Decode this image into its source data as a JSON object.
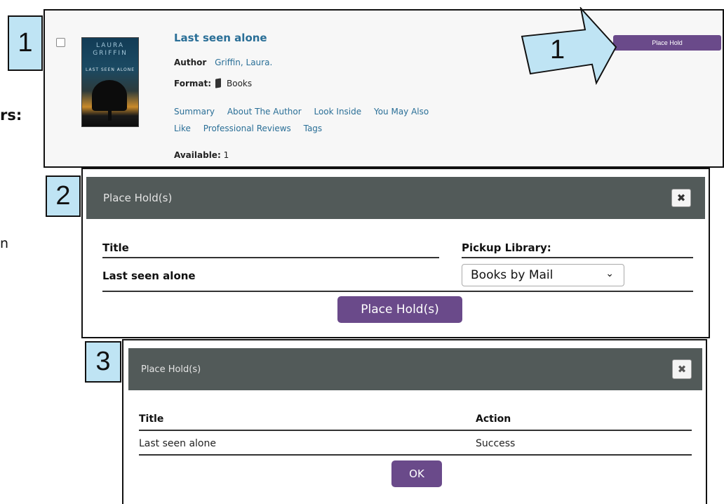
{
  "left_fragments": {
    "colon_text": "rs:",
    "n_text": "n"
  },
  "step_labels": [
    "1",
    "2",
    "3"
  ],
  "arrow_label": "1",
  "result_item": {
    "title": "Last seen alone",
    "author_label": "Author",
    "author_value": "Griffin, Laura.",
    "format_label": "Format:",
    "format_value": "Books",
    "links_row1": [
      "Summary",
      "About The Author",
      "Look Inside",
      "You May Also"
    ],
    "links_row2": [
      "Like",
      "Professional Reviews",
      "Tags"
    ],
    "available_label": "Available:",
    "available_value": "1",
    "place_hold_button": "Place Hold",
    "cover": {
      "author_line1": "LAURA",
      "author_line2": "GRIFFIN",
      "title_text": "LAST SEEN ALONE"
    }
  },
  "place_hold_dialog": {
    "title": "Place Hold(s)",
    "close_icon": "close-icon",
    "col_title": "Title",
    "col_pickup": "Pickup Library:",
    "row_title": "Last seen alone",
    "pickup_selected": "Books by Mail",
    "submit_button": "Place Hold(s)"
  },
  "result_dialog": {
    "title": "Place Hold(s)",
    "close_icon": "close-icon",
    "col_title": "Title",
    "col_action": "Action",
    "row_title": "Last seen alone",
    "row_action": "Success",
    "ok_button": "OK"
  },
  "colors": {
    "link_blue": "#2a6f97",
    "button_purple": "#6a4a8a",
    "dialog_header": "#525a59",
    "step_label_fill": "#bfe4f4"
  }
}
